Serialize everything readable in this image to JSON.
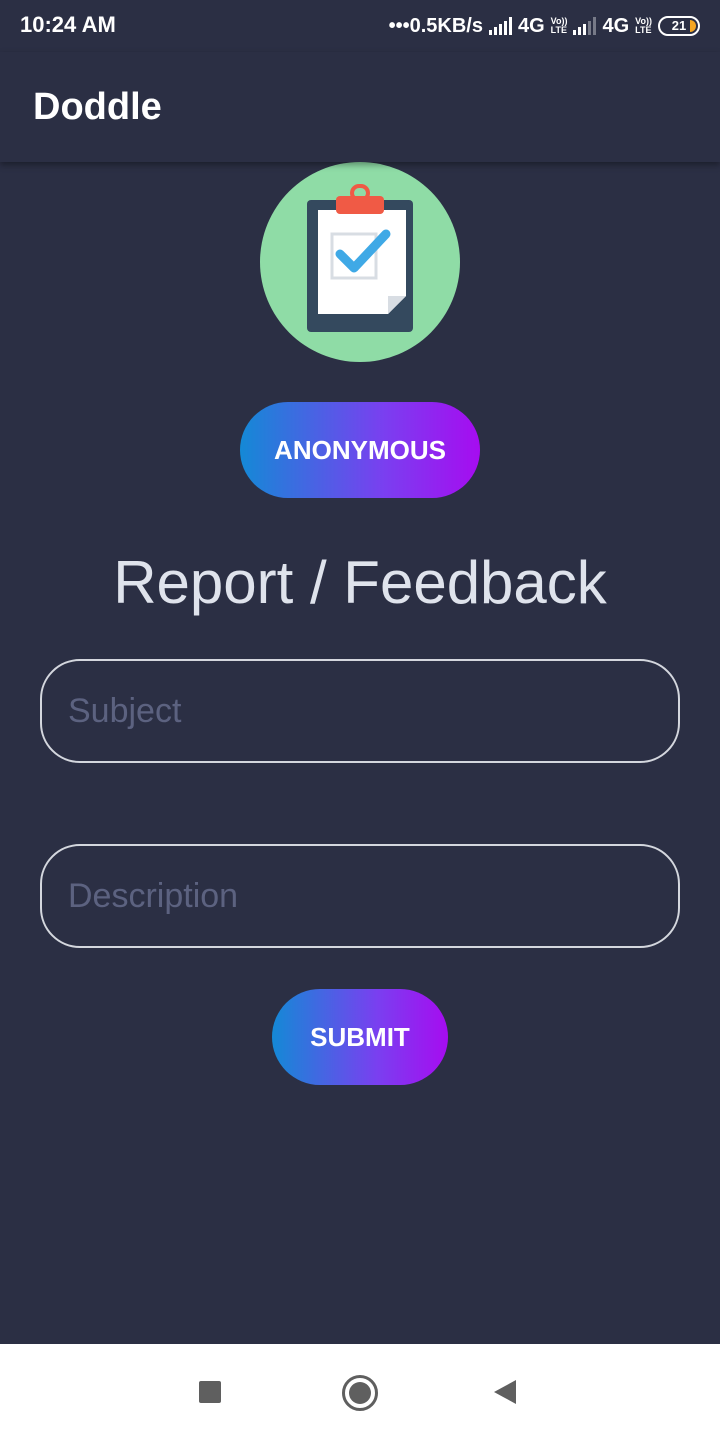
{
  "status_bar": {
    "time": "10:24 AM",
    "network_speed": "•••0.5KB/s",
    "network_type_1": "4G",
    "network_type_2": "4G",
    "volte_top": "Vo))",
    "volte_bottom": "LTE",
    "battery_level": "21"
  },
  "app_bar": {
    "title": "Doddle"
  },
  "logo": {
    "icon": "clipboard-check-icon",
    "background_color": "#8fdca6"
  },
  "anonymous_button": {
    "label": "ANONYMOUS"
  },
  "heading": "Report / Feedback",
  "form": {
    "subject_placeholder": "Subject",
    "subject_value": "",
    "description_placeholder": "Description",
    "description_value": ""
  },
  "submit_button": {
    "label": "SUBMIT"
  },
  "nav_bar": {
    "recents_icon": "square-icon",
    "home_icon": "circle-icon",
    "back_icon": "triangle-back-icon"
  },
  "colors": {
    "background": "#2b2f44",
    "gradient_start": "#1489d6",
    "gradient_end": "#a60cf0",
    "heading_text": "#dfe3ec",
    "placeholder_text": "#5c6280",
    "battery_charge": "#f5a623"
  }
}
